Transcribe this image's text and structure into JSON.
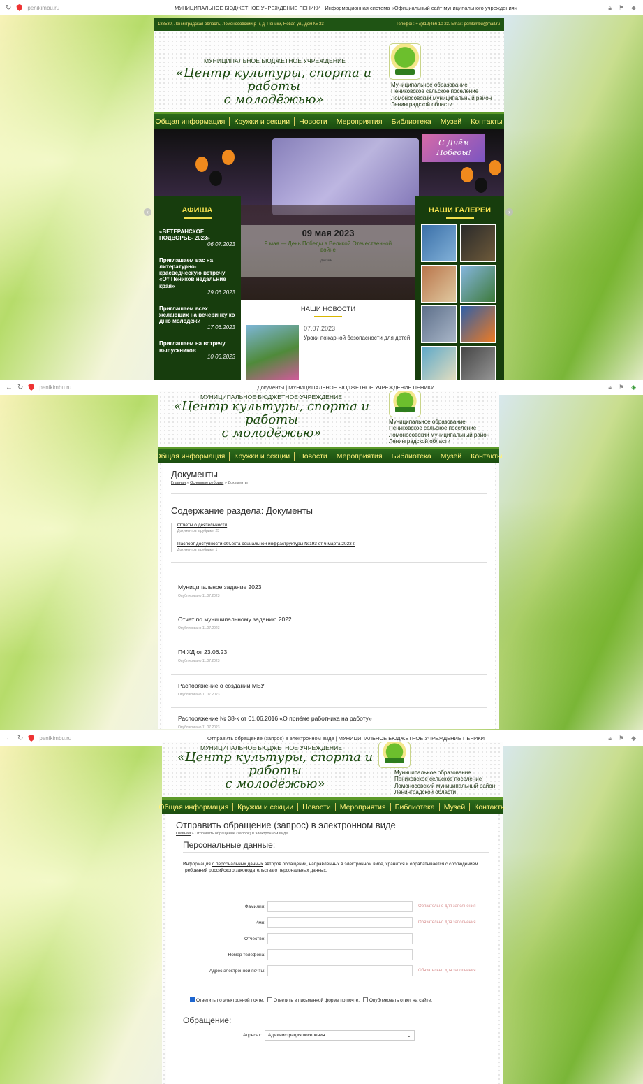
{
  "browser": {
    "url": "penikimbu.ru",
    "tab1_title": "МУНИЦИПАЛЬНОЕ БЮДЖЕТНОЕ УЧРЕЖДЕНИЕ ПЕНИКИ | Информационная система «Официальный сайт муниципального учреждения»",
    "tab2_title": "Документы | МУНИЦИПАЛЬНОЕ БЮДЖЕТНОЕ УЧРЕЖДЕНИЕ ПЕНИКИ",
    "tab3_title": "Отправить обращение (запрос) в электронном виде | МУНИЦИПАЛЬНОЕ БЮДЖЕТНОЕ УЧРЕЖДЕНИЕ ПЕНИКИ"
  },
  "site": {
    "address": "188530, Ленинградская область, Ломоносовский р-н, д. Пеники, Новая ул., дом № 33",
    "contacts": "Телефон: +7(812)456 10 23. Email: penikimbu@mail.ru",
    "org_type": "МУНИЦИПАЛЬНОЕ БЮДЖЕТНОЕ УЧРЕЖДЕНИЕ",
    "name_line1": "«Центр культуры, спорта и работы",
    "name_line2": "с молодёжью»",
    "region": [
      "Муниципальное образование",
      "Пениковское сельское поселение",
      "Ломоносовский муниципальный район",
      "Ленинградской области"
    ]
  },
  "menu": [
    "Общая информация",
    "Кружки и секции",
    "Новости",
    "Мероприятия",
    "Библиотека",
    "Музей",
    "Контакты"
  ],
  "home": {
    "afisha_title": "АФИША",
    "afisha": [
      {
        "title": "«ВЕТЕРАНСКОЕ ПОДВОРЬЕ- 2023»",
        "date": "06.07.2023"
      },
      {
        "title": "Приглашаем вас на литературно-краеведческую встречу «От Пеников недальние края»",
        "date": "29.06.2023"
      },
      {
        "title": "Приглашаем всех желающих на вечеринку ко дню молодежи",
        "date": "17.06.2023"
      },
      {
        "title": "Приглашаем на встречу выпускников",
        "date": "10.06.2023"
      }
    ],
    "galleries_title": "НАШИ ГАЛЕРЕИ",
    "slide_date": "09 мая 2023",
    "slide_text": "9 мая — День Победы в Великой Отечественной войне",
    "slide_more": "далее...",
    "news_title": "НАШИ НОВОСТИ",
    "news_date": "07.07.2023",
    "news_text": "Уроки пожарной безопасности для детей",
    "banner_text": "С Днём Победы!"
  },
  "docs": {
    "title": "Документы",
    "crumb_home": "Главная",
    "crumb_mid": "Основные рубрики",
    "crumb_current": "Документы",
    "section_title": "Содержание раздела: Документы",
    "categories": [
      {
        "name": "Отчеты о деятельности",
        "count": "Документов в рубрике: 25"
      },
      {
        "name": "Паспорт доступности объекта социальной инфраструктуры №193 от 6 марта 2023 г.",
        "count": "Документов в рубрике: 1"
      }
    ],
    "items": [
      {
        "title": "Муниципальное задание 2023",
        "published": "Опубликовано 11.07.2023"
      },
      {
        "title": "Отчет по муниципальному заданию 2022",
        "published": "Опубликовано 11.07.2023"
      },
      {
        "title": "ПФХД от 23.06.23",
        "published": "Опубликовано 11.07.2023"
      },
      {
        "title": "Распоряжение о создании МБУ",
        "published": "Опубликовано 11.07.2023"
      },
      {
        "title": "Распоряжение № 38-к от 01.06.2016 «О приёме работника на работу»",
        "published": "Опубликовано 11.07.2023"
      }
    ]
  },
  "form": {
    "title": "Отправить обращение (запрос) в электронном виде",
    "crumb_home": "Главная",
    "crumb_current": "Отправить обращение (запрос) в электронном виде",
    "personal_title": "Персональные данные:",
    "info_prefix": "Информация ",
    "info_link": "о персональных данных",
    "info_rest": " авторов обращений, направленных в электронном виде, хранится и обрабатывается с соблюдением требований российского законодательства о персональных данных.",
    "required_text": "Обязательно для заполнения",
    "fields": {
      "surname": "Фамилия:",
      "name": "Имя:",
      "patronymic": "Отчество:",
      "phone": "Номер телефона:",
      "email": "Адрес электронной почты:"
    },
    "opt_email": "Ответить по электронной почте.",
    "opt_post": "Ответить в письменной форме по почте.",
    "opt_publish": "Опубликовать ответ на сайте.",
    "appeal_title": "Обращение:",
    "addressee_label": "Адресат:",
    "addressee_value": "Администрация поселения"
  }
}
